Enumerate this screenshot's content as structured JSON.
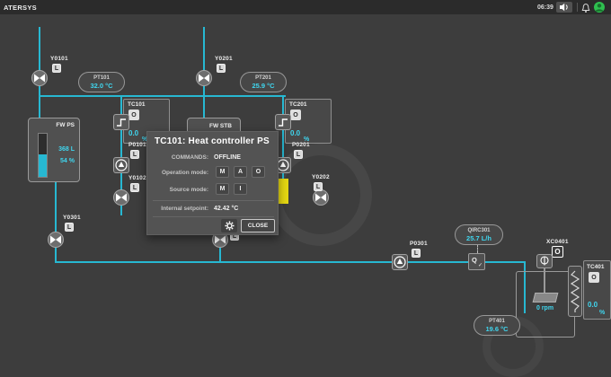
{
  "topbar": {
    "app_title": "ATERSYS",
    "time": "06:39"
  },
  "colors": {
    "pipe_cyan": "#27b8d2",
    "value_cyan": "#3fd6ef",
    "alarm_yellow": "#e6d812",
    "user_green": "#2fbf4f",
    "background": "#3d3d3d"
  },
  "popup": {
    "title": "TC101: Heat controller PS",
    "commands_label": "COMMANDS:",
    "commands_value": "OFFLINE",
    "operation_mode_label": "Operation mode:",
    "operation_modes": [
      "M",
      "A",
      "O"
    ],
    "source_mode_label": "Source mode:",
    "source_modes": [
      "M",
      "I"
    ],
    "setpoint_label": "Internal setpoint:",
    "setpoint_value": "42.42 °C",
    "close_label": "CLOSE"
  },
  "tanks": {
    "fw_ps": {
      "label": "FW PS",
      "volume": "368 L",
      "level": "54 %"
    },
    "fw_stb": {
      "label": "FW STB"
    }
  },
  "gauges": {
    "pt101": {
      "name": "PT101",
      "value": "32.0 °C"
    },
    "pt201": {
      "name": "PT201",
      "value": "25.9 °C"
    },
    "qirc301": {
      "name": "QIRC301",
      "value": "25.7 L/h"
    },
    "pt401": {
      "name": "PT401",
      "value": "19.6 °C"
    }
  },
  "controllers": {
    "tc101": {
      "label": "TC101",
      "mode_button": "O",
      "value": "0.0",
      "unit": "%"
    },
    "tc201": {
      "label": "TC201",
      "mode_button": "O",
      "value": "0.0",
      "unit": "%"
    },
    "tc401": {
      "label": "TC401",
      "mode_button": "O",
      "value": "0.0",
      "unit": "%"
    }
  },
  "valves": {
    "y0101": {
      "label": "Y0101",
      "badge": "L"
    },
    "y0201": {
      "label": "Y0201",
      "badge": "L"
    },
    "y0102": {
      "label": "Y0102",
      "badge": "L"
    },
    "y0202": {
      "label": "Y0202",
      "badge": "L"
    },
    "y0301": {
      "label": "Y0301",
      "badge": "L"
    },
    "y0302": {
      "badge": "L"
    }
  },
  "pumps": {
    "p0101": {
      "label": "P0101",
      "badge": "L"
    },
    "p0201": {
      "label": "P0201",
      "badge": "L"
    },
    "p0301": {
      "label": "P0301",
      "badge": "L"
    }
  },
  "mixer": {
    "label": "XC0401",
    "badge": "O",
    "speed": "0 rpm"
  },
  "flow_sensor": {
    "letter": "Q",
    "check": "✓"
  }
}
